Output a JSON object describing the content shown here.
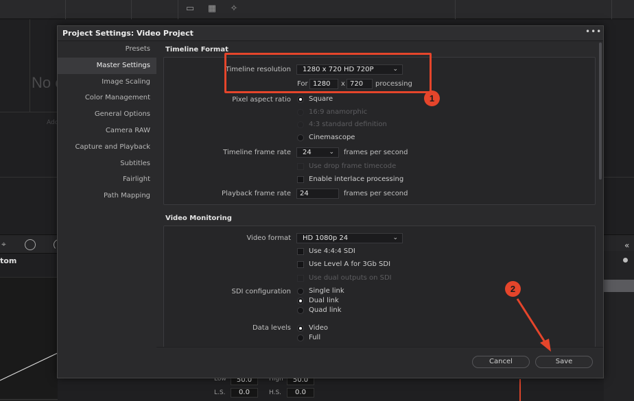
{
  "dialog": {
    "title": "Project Settings:  Video Project",
    "menu_icon": "more-horizontal-icon",
    "menu_glyph": "•••"
  },
  "sidebar": {
    "items": [
      {
        "label": "Presets",
        "active": false
      },
      {
        "label": "Master Settings",
        "active": true
      },
      {
        "label": "Image Scaling",
        "active": false
      },
      {
        "label": "Color Management",
        "active": false
      },
      {
        "label": "General Options",
        "active": false
      },
      {
        "label": "Camera RAW",
        "active": false
      },
      {
        "label": "Capture and Playback",
        "active": false
      },
      {
        "label": "Subtitles",
        "active": false
      },
      {
        "label": "Fairlight",
        "active": false
      },
      {
        "label": "Path Mapping",
        "active": false
      }
    ]
  },
  "timeline_format": {
    "title": "Timeline Format",
    "resolution_label": "Timeline resolution",
    "resolution_value": "1280 x 720 HD 720P",
    "for_label": "For",
    "width": "1280",
    "x_label": "x",
    "height": "720",
    "processing_label": "processing",
    "pixel_aspect_label": "Pixel aspect ratio",
    "pixel_aspect_options": [
      {
        "label": "Square",
        "selected": true,
        "enabled": true
      },
      {
        "label": "16:9 anamorphic",
        "selected": false,
        "enabled": false
      },
      {
        "label": "4:3 standard definition",
        "selected": false,
        "enabled": false
      },
      {
        "label": "Cinemascope",
        "selected": false,
        "enabled": true
      }
    ],
    "frame_rate_label": "Timeline frame rate",
    "frame_rate_value": "24",
    "fps_label": "frames per second",
    "drop_frame_label": "Use drop frame timecode",
    "interlace_label": "Enable interlace processing",
    "playback_rate_label": "Playback frame rate",
    "playback_rate_value": "24",
    "playback_fps_label": "frames per second"
  },
  "video_monitoring": {
    "title": "Video Monitoring",
    "format_label": "Video format",
    "format_value": "HD 1080p 24",
    "use_444": "Use 4:4:4 SDI",
    "use_level_a": "Use Level A for 3Gb SDI",
    "use_dual": "Use dual outputs on SDI",
    "sdi_label": "SDI configuration",
    "sdi_options": [
      {
        "label": "Single link",
        "selected": false
      },
      {
        "label": "Dual link",
        "selected": true
      },
      {
        "label": "Quad link",
        "selected": false
      }
    ],
    "data_levels_label": "Data levels",
    "data_levels_options": [
      {
        "label": "Video",
        "selected": true
      },
      {
        "label": "Full",
        "selected": false
      }
    ]
  },
  "footer": {
    "cancel_label": "Cancel",
    "save_label": "Save"
  },
  "annotations": {
    "badge_1": "1",
    "badge_2": "2",
    "accent": "#e5452b"
  },
  "background": {
    "no_clip_text": "No c",
    "add_text": "Add",
    "tom_label": "tom",
    "low_label": "Low",
    "low_value": "50.0",
    "high_label": "High",
    "high_value": "50.0",
    "ls_label": "L.S.",
    "ls_value": "0.0",
    "hs_label": "H.S.",
    "hs_value": "0.0"
  }
}
